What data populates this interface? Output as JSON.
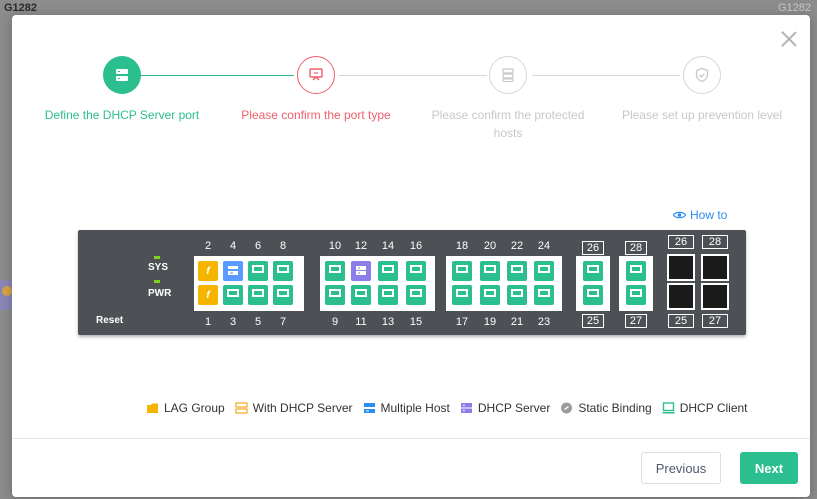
{
  "background": {
    "title": "G1282",
    "title_right": "G1282"
  },
  "stepper": {
    "steps": [
      {
        "label": "Define the DHCP Server port",
        "state": "done",
        "icon": "server-icon"
      },
      {
        "label": "Please confirm the port type",
        "state": "current",
        "icon": "port-type-icon"
      },
      {
        "label": "Please confirm the protected hosts",
        "state": "pending",
        "icon": "hosts-icon"
      },
      {
        "label": "Please set up prevention level",
        "state": "pending",
        "icon": "shield-icon"
      }
    ]
  },
  "how_to": "How to",
  "switch": {
    "sys_label": "SYS",
    "pwr_label": "PWR",
    "reset_label": "Reset",
    "top_numbers": [
      "2",
      "4",
      "6",
      "8",
      "10",
      "12",
      "14",
      "16",
      "18",
      "20",
      "22",
      "24"
    ],
    "bottom_numbers": [
      "1",
      "3",
      "5",
      "7",
      "9",
      "11",
      "13",
      "15",
      "17",
      "19",
      "21",
      "23"
    ],
    "boxed_top": [
      "26",
      "28"
    ],
    "boxed_bottom": [
      "25",
      "27"
    ],
    "sfp_top": [
      "26",
      "28"
    ],
    "sfp_bottom": [
      "25",
      "27"
    ],
    "lag_glyph": "f"
  },
  "legend": [
    {
      "label": "LAG Group",
      "icon": "lag-group-icon",
      "color": "#f5b400"
    },
    {
      "label": "With DHCP Server",
      "icon": "with-dhcp-server-icon",
      "color": "#f5a623"
    },
    {
      "label": "Multiple Host",
      "icon": "multiple-host-icon",
      "color": "#2d8cf0"
    },
    {
      "label": "DHCP Server",
      "icon": "dhcp-server-icon",
      "color": "#8c7ee8"
    },
    {
      "label": "Static Binding",
      "icon": "static-binding-icon",
      "color": "#9b9b9b"
    },
    {
      "label": "DHCP Client",
      "icon": "dhcp-client-icon",
      "color": "#2bbf8f"
    }
  ],
  "buttons": {
    "previous": "Previous",
    "next": "Next"
  },
  "colors": {
    "accent": "#2bbf8f",
    "current": "#f0606c",
    "pending": "#c8c8c8",
    "link": "#2d8cf0"
  }
}
